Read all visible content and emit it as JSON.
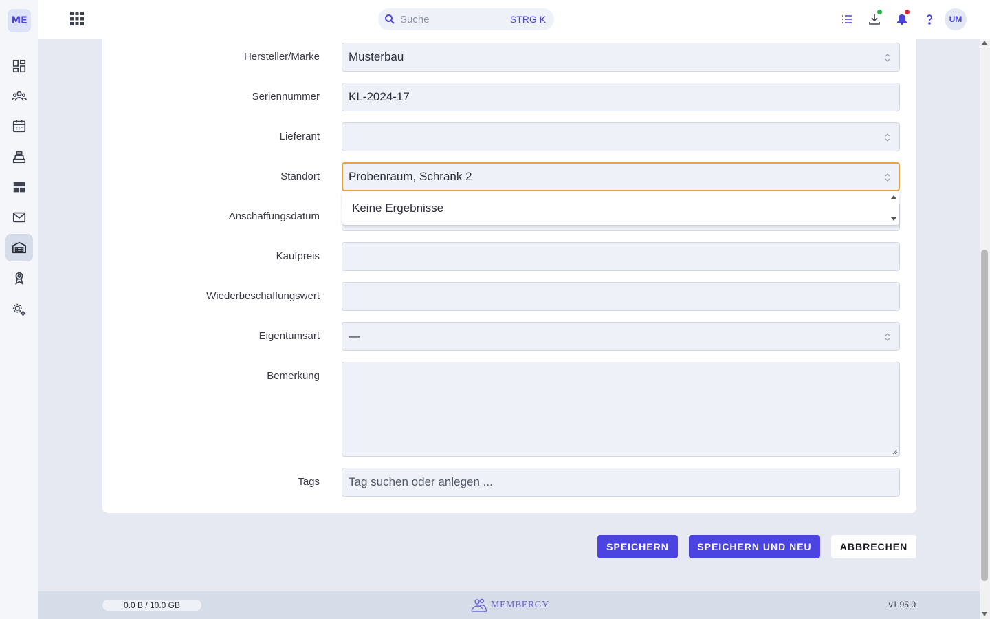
{
  "app": {
    "logo_text": "ME"
  },
  "sidebar": {
    "items": [
      {
        "name": "dashboard",
        "icon": "dashboard-icon",
        "active": false
      },
      {
        "name": "members",
        "icon": "people-icon",
        "active": false
      },
      {
        "name": "calendar",
        "icon": "calendar-icon",
        "active": false
      },
      {
        "name": "cash-register",
        "icon": "register-icon",
        "active": false
      },
      {
        "name": "layout",
        "icon": "layout-icon",
        "active": false
      },
      {
        "name": "mail",
        "icon": "mail-icon",
        "active": false
      },
      {
        "name": "inventory",
        "icon": "warehouse-icon",
        "active": true
      },
      {
        "name": "awards",
        "icon": "award-icon",
        "active": false
      },
      {
        "name": "settings",
        "icon": "gear-icon",
        "active": false
      }
    ]
  },
  "header": {
    "search_placeholder": "Suche",
    "search_shortcut": "STRG K",
    "avatar_initials": "UM",
    "icons": [
      "list-icon",
      "download-icon",
      "bell-icon",
      "help-icon"
    ]
  },
  "form": {
    "fields": [
      {
        "label": "Hersteller/Marke",
        "value": "Musterbau",
        "type": "select"
      },
      {
        "label": "Seriennummer",
        "value": "KL-2024-17",
        "type": "text"
      },
      {
        "label": "Lieferant",
        "value": "",
        "type": "select"
      },
      {
        "label": "Standort",
        "value": "Probenraum, Schrank 2",
        "type": "select",
        "focused": true
      },
      {
        "label": "Anschaffungsdatum",
        "value": "",
        "type": "date"
      },
      {
        "label": "Kaufpreis",
        "value": "",
        "type": "text"
      },
      {
        "label": "Wiederbeschaffungswert",
        "value": "",
        "type": "text"
      },
      {
        "label": "Eigentumsart",
        "value": "—",
        "type": "select"
      },
      {
        "label": "Bemerkung",
        "value": "",
        "type": "textarea"
      },
      {
        "label": "Tags",
        "placeholder": "Tag suchen oder anlegen ...",
        "type": "tags"
      }
    ],
    "dropdown_message": "Keine Ergebnisse"
  },
  "actions": {
    "save": "SPEICHERN",
    "save_and_new": "SPEICHERN UND NEU",
    "cancel": "ABBRECHEN"
  },
  "footer": {
    "storage": "0.0 B / 10.0 GB",
    "brand": "MEMBERGY",
    "version": "v1.95.0"
  },
  "colors": {
    "accent": "#4b44e0",
    "focus_border": "#e8a33b",
    "notification_green": "#2fb34a",
    "notification_red": "#e0283a"
  }
}
